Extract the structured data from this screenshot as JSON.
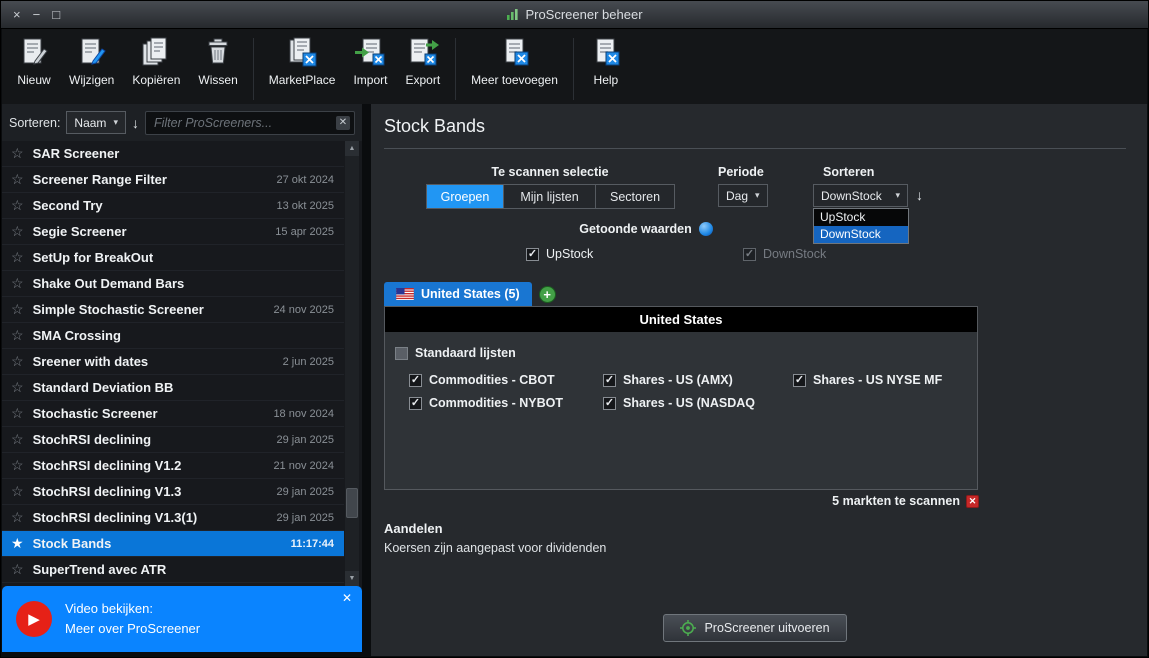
{
  "window": {
    "title": "ProScreener beheer"
  },
  "icons": {
    "close": "×",
    "minimize": "−",
    "maximize": "□",
    "caret_down": "▾",
    "sort_arrow": "↓",
    "star_outline": "☆",
    "star_filled": "★",
    "check": "✓",
    "clear_x": "✕",
    "banner_close": "✕",
    "remove_x": "✕",
    "plus": "+",
    "play": "▶",
    "scroll_up": "▲",
    "scroll_down": "▼"
  },
  "colors": {
    "accent_blue": "#2196f3",
    "tab_blue": "#1976d2",
    "banner_blue": "#0a84ff",
    "selected_row_blue": "#0a76d8",
    "menu_highlight_blue": "#1565c0",
    "alert_red": "#c62828",
    "action_green": "#43a047"
  },
  "toolbar": {
    "items": [
      {
        "label": "Nieuw"
      },
      {
        "label": "Wijzigen"
      },
      {
        "label": "Kopiëren"
      },
      {
        "label": "Wissen"
      },
      {
        "label": "MarketPlace"
      },
      {
        "label": "Import"
      },
      {
        "label": "Export"
      },
      {
        "label": "Meer toevoegen"
      },
      {
        "label": "Help"
      }
    ]
  },
  "sidebar": {
    "sort_label": "Sorteren:",
    "sort_value": "Naam",
    "filter_placeholder": "Filter ProScreeners...",
    "items": [
      {
        "name": "SAR Screener",
        "date": ""
      },
      {
        "name": "Screener Range Filter",
        "date": "27 okt 2024"
      },
      {
        "name": "Second Try",
        "date": "13 okt 2025"
      },
      {
        "name": "Segie Screener",
        "date": "15 apr 2025"
      },
      {
        "name": "SetUp for BreakOut",
        "date": ""
      },
      {
        "name": "Shake Out Demand Bars",
        "date": ""
      },
      {
        "name": "Simple Stochastic Screener",
        "date": "24 nov 2025"
      },
      {
        "name": "SMA Crossing",
        "date": ""
      },
      {
        "name": "Sreener with dates",
        "date": "2 jun 2025"
      },
      {
        "name": "Standard Deviation BB",
        "date": ""
      },
      {
        "name": "Stochastic Screener",
        "date": "18 nov 2024"
      },
      {
        "name": "StochRSI declining",
        "date": "29 jan 2025"
      },
      {
        "name": "StochRSI declining V1.2",
        "date": "21 nov 2024"
      },
      {
        "name": "StochRSI declining V1.3",
        "date": "29 jan 2025"
      },
      {
        "name": "StochRSI declining V1.3(1)",
        "date": "29 jan 2025"
      },
      {
        "name": "Stock Bands",
        "date": "11:17:44",
        "selected": true
      },
      {
        "name": "SuperTrend avec ATR",
        "date": ""
      }
    ],
    "video_banner": {
      "line1": "Video bekijken:",
      "line2": "Meer over ProScreener"
    }
  },
  "main": {
    "title": "Stock Bands",
    "selection": {
      "label": "Te scannen selectie",
      "options": [
        "Groepen",
        "Mijn lijsten",
        "Sectoren"
      ],
      "active": "Groepen"
    },
    "periode": {
      "label": "Periode",
      "value": "Dag"
    },
    "sorteren": {
      "label": "Sorteren",
      "value": "DownStock",
      "menu": [
        "UpStock",
        "DownStock"
      ],
      "menu_selected": "DownStock"
    },
    "getoonde_label": "Getoonde waarden",
    "value_checkboxes": [
      {
        "label": "UpStock",
        "checked": true,
        "disabled": false
      },
      {
        "label": "DownStock",
        "checked": true,
        "disabled": true
      }
    ],
    "tab": {
      "label": "United States (5)"
    },
    "table": {
      "header": "United States",
      "standard_label": "Standaard lijsten",
      "standard_checked": false,
      "markets": [
        {
          "label": "Commodities - CBOT",
          "checked": true
        },
        {
          "label": "Shares - US (AMX)",
          "checked": true
        },
        {
          "label": "Shares - US NYSE MF",
          "checked": true
        },
        {
          "label": "Commodities - NYBOT",
          "checked": true
        },
        {
          "label": "Shares - US (NASDAQ",
          "checked": true
        }
      ]
    },
    "count_text": "5 markten te scannen",
    "aandelen_title": "Aandelen",
    "aandelen_text": "Koersen zijn aangepast voor dividenden",
    "run_button": "ProScreener uitvoeren"
  }
}
